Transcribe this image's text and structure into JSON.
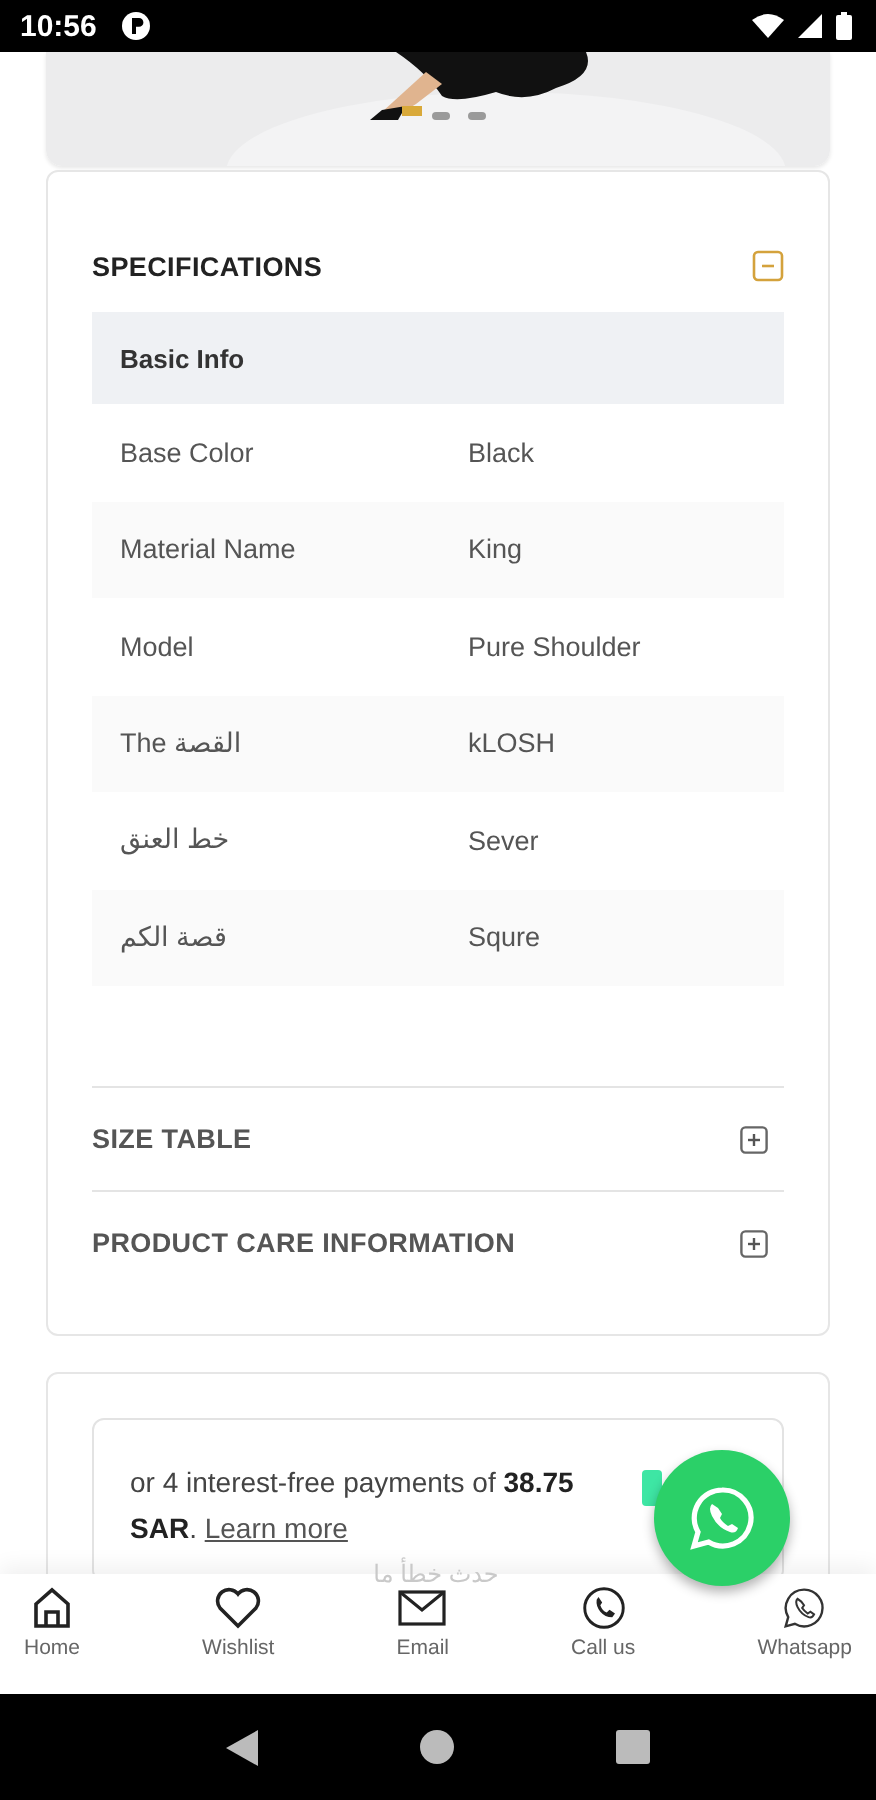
{
  "status_bar": {
    "time": "10:56"
  },
  "specifications": {
    "title": "SPECIFICATIONS",
    "expanded": true,
    "group": "Basic Info",
    "rows": [
      {
        "name": "Base Color",
        "value": "Black"
      },
      {
        "name": "Material Name",
        "value": "King"
      },
      {
        "name": "Model",
        "value": "Pure Shoulder"
      },
      {
        "name": "The القصة",
        "value": "kLOSH"
      },
      {
        "name": "خط العنق",
        "value": "Sever"
      },
      {
        "name": "قصة الكم",
        "value": "Squre"
      }
    ]
  },
  "sections": [
    {
      "title": "SIZE TABLE",
      "expanded": false
    },
    {
      "title": "PRODUCT CARE INFORMATION",
      "expanded": false
    }
  ],
  "installments": {
    "text": "or 4 interest-free payments of **38.75 SAR**.",
    "link": "Learn more"
  },
  "toast": "حدث خطأ ما",
  "nav": [
    {
      "label": "Home"
    },
    {
      "label": "Wishlist"
    },
    {
      "label": "Email"
    },
    {
      "label": "Call us"
    },
    {
      "label": "Whatsapp"
    }
  ]
}
